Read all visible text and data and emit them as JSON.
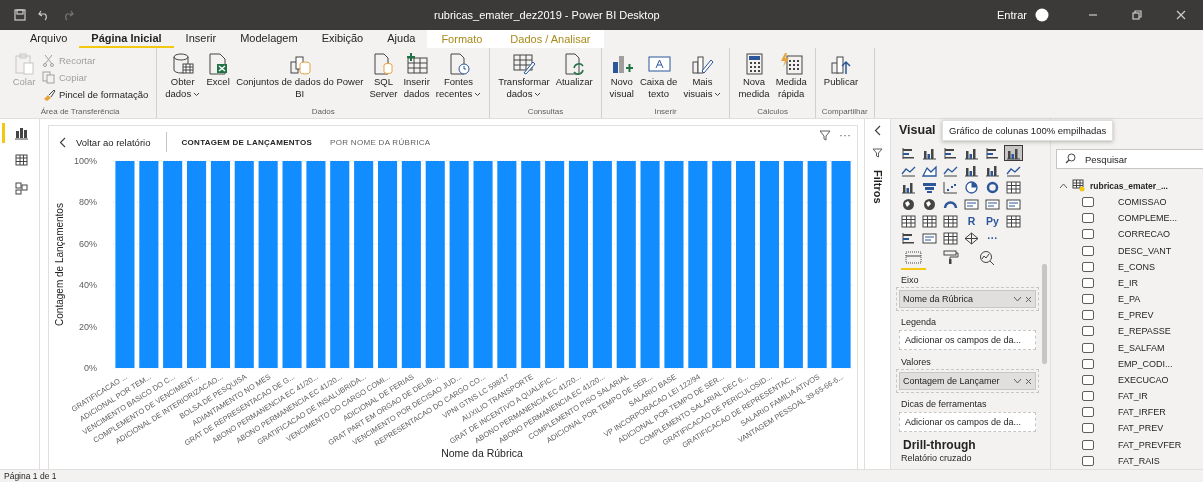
{
  "title_bar": {
    "title": "rubricas_emater_dez2019 - Power BI Desktop",
    "sign_in": "Entrar"
  },
  "ribbon_tabs": [
    {
      "label": "Arquivo",
      "selected": false,
      "kind": "normal"
    },
    {
      "label": "Página Inicial",
      "selected": true,
      "kind": "normal"
    },
    {
      "label": "Inserir",
      "selected": false,
      "kind": "normal"
    },
    {
      "label": "Modelagem",
      "selected": false,
      "kind": "normal"
    },
    {
      "label": "Exibição",
      "selected": false,
      "kind": "normal"
    },
    {
      "label": "Ajuda",
      "selected": false,
      "kind": "normal"
    },
    {
      "label": "Formato",
      "selected": false,
      "kind": "contextual"
    },
    {
      "label": "Dados / Analisar",
      "selected": false,
      "kind": "contextual"
    }
  ],
  "ribbon_groups": [
    {
      "label": "Área de Transferência",
      "buttons": [
        {
          "kind": "large",
          "label": "Colar",
          "disabled": true,
          "dropdown": false
        },
        {
          "kind": "small",
          "label": "Recortar",
          "disabled": true,
          "dropdown": false
        },
        {
          "kind": "small",
          "label": "Copiar",
          "disabled": true,
          "dropdown": false
        },
        {
          "kind": "small",
          "label": "Pincel de formatação",
          "disabled": false,
          "dropdown": false
        }
      ]
    },
    {
      "label": "Dados",
      "buttons": [
        {
          "kind": "large",
          "label": "Obter\ndados",
          "disabled": false,
          "dropdown": true
        },
        {
          "kind": "large",
          "label": "Excel",
          "disabled": false,
          "dropdown": false
        },
        {
          "kind": "large",
          "label": "Conjuntos de dados do Power\nBI",
          "disabled": false,
          "dropdown": false
        },
        {
          "kind": "large",
          "label": "SQL\nServer",
          "disabled": false,
          "dropdown": false
        },
        {
          "kind": "large",
          "label": "Inserir\ndados",
          "disabled": false,
          "dropdown": false
        },
        {
          "kind": "large",
          "label": "Fontes\nrecentes",
          "disabled": false,
          "dropdown": true
        }
      ]
    },
    {
      "label": "Consultas",
      "buttons": [
        {
          "kind": "large",
          "label": "Transformar\ndados",
          "disabled": false,
          "dropdown": true
        },
        {
          "kind": "large",
          "label": "Atualizar",
          "disabled": false,
          "dropdown": false
        }
      ]
    },
    {
      "label": "Inserir",
      "buttons": [
        {
          "kind": "large",
          "label": "Novo\nvisual",
          "disabled": false,
          "dropdown": false
        },
        {
          "kind": "large",
          "label": "Caixa de\ntexto",
          "disabled": false,
          "dropdown": false
        },
        {
          "kind": "large",
          "label": "Mais\nvisuais",
          "disabled": false,
          "dropdown": true
        }
      ]
    },
    {
      "label": "Cálculos",
      "buttons": [
        {
          "kind": "large",
          "label": "Nova\nmedida",
          "disabled": false,
          "dropdown": false
        },
        {
          "kind": "large",
          "label": "Medida\nrápida",
          "disabled": false,
          "dropdown": false
        }
      ]
    },
    {
      "label": "Compartilhar",
      "buttons": [
        {
          "kind": "large",
          "label": "Publicar",
          "disabled": false,
          "dropdown": false
        }
      ]
    }
  ],
  "views": [
    {
      "selected": true
    },
    {
      "selected": false
    },
    {
      "selected": false
    }
  ],
  "visual_header": {
    "back": "Voltar ao relatório",
    "measure": "CONTAGEM DE LANÇAMENTOS",
    "by": "POR NOME DA RÚBRICA",
    "more": "···"
  },
  "chart_data": {
    "type": "bar",
    "xlabel": "Nome da Rúbrica",
    "ylabel": "Contagem de Lançamentos",
    "grid": true,
    "ylim": [
      0,
      100
    ],
    "yticks": [
      {
        "value": 0,
        "label": "0%"
      },
      {
        "value": 20,
        "label": "20%"
      },
      {
        "value": 40,
        "label": "40%"
      },
      {
        "value": 60,
        "label": "60%"
      },
      {
        "value": 80,
        "label": "80%"
      },
      {
        "value": 100,
        "label": "100%"
      }
    ],
    "categories": [
      "GRATIFICACAO ...",
      "ADICIONAL POR TEM...",
      "VENCIMENTO BASICO DO C...",
      "COMPLEMENTO DE VENCIMENT...",
      "ADICIONAL DE INTERIORIZACAO...",
      "BOLSA DE PESQUISA",
      "ADIANTAMENTO NO MES",
      "GRAT DE REPRESENTACAO DE G...",
      "ABONO PERMANENCIA EC 41/20...",
      "ABONO PERMANENCIA EC 41/20...",
      "GRATIFICACAO DE INSALUBRIDA...",
      "VENCIMENTO DO CARGO COMI...",
      "ADICIONAL DE FERIAS",
      "GRAT PART EM ORGAO DE DELIB...",
      "VENCIMENTO POR DECISAO JUD...",
      "REPRESENTACAO DO CARGO CO...",
      "VPNI GTNS LC 598/17",
      "AUXILIO TRANSPORTE",
      "GRAT DE INCENTIVO A QUALIFIC...",
      "ABONO PERMANENCIA EC 41/20...",
      "ABONO PERMANENCIA EC 41/20...",
      "COMPLEMENTO PISO SALARIAL",
      "ADICIONAL POR TEMPO DE SER...",
      "SALARIO BASE",
      "VP INCORPORACAO LEI 122/94",
      "ADICIONAL POR TEMPO DE SER...",
      "COMPLEMENTO SALARIAL DEC 6...",
      "GRATIFICACAO DE PERICULOSID...",
      "GRATIFICACAO DE REPRESENTAC...",
      "SALARIO FAMILIA ATIVOS",
      "VANTAGEM PESSOAL 39-65-66-6..."
    ],
    "series": [
      {
        "color": "#118dff",
        "values": [
          100,
          100,
          100,
          100,
          100,
          100,
          100,
          100,
          100,
          100,
          100,
          100,
          100,
          100,
          100,
          100,
          100,
          100,
          100,
          100,
          100,
          100,
          100,
          100,
          100,
          100,
          100,
          100,
          100,
          100,
          100
        ]
      }
    ]
  },
  "filters_pane": {
    "title": "Filtros"
  },
  "visualizations_pane": {
    "title": "Visual",
    "tooltip": "Gráfico de colunas 100% empilhadas",
    "visual_types": [
      {
        "kind": "icon",
        "selected": false
      },
      {
        "kind": "icon",
        "selected": false
      },
      {
        "kind": "icon",
        "selected": false
      },
      {
        "kind": "icon",
        "selected": false
      },
      {
        "kind": "icon",
        "selected": false
      },
      {
        "kind": "icon",
        "selected": true
      },
      {
        "kind": "icon",
        "selected": false
      },
      {
        "kind": "icon",
        "selected": false
      },
      {
        "kind": "icon",
        "selected": false
      },
      {
        "kind": "icon",
        "selected": false
      },
      {
        "kind": "icon",
        "selected": false
      },
      {
        "kind": "icon",
        "selected": false
      },
      {
        "kind": "icon",
        "selected": false
      },
      {
        "kind": "icon",
        "selected": false
      },
      {
        "kind": "icon",
        "selected": false
      },
      {
        "kind": "icon",
        "selected": false
      },
      {
        "kind": "icon",
        "selected": false
      },
      {
        "kind": "icon",
        "selected": false
      },
      {
        "kind": "icon",
        "selected": false
      },
      {
        "kind": "icon",
        "selected": false
      },
      {
        "kind": "icon",
        "selected": false
      },
      {
        "kind": "icon",
        "selected": false
      },
      {
        "kind": "icon",
        "selected": false
      },
      {
        "kind": "icon",
        "selected": false
      },
      {
        "kind": "icon",
        "selected": false
      },
      {
        "kind": "icon",
        "selected": false
      },
      {
        "kind": "icon",
        "selected": false
      },
      {
        "kind": "text",
        "text": "R",
        "selected": false
      },
      {
        "kind": "text",
        "text": "Py",
        "selected": false
      },
      {
        "kind": "icon",
        "selected": false
      },
      {
        "kind": "icon",
        "selected": false
      },
      {
        "kind": "icon",
        "selected": false
      },
      {
        "kind": "icon",
        "selected": false
      },
      {
        "kind": "icon",
        "selected": false
      },
      {
        "kind": "text",
        "text": "···",
        "selected": false
      }
    ],
    "pane_tabs": [
      {
        "selected": true
      },
      {
        "selected": false
      },
      {
        "selected": false
      }
    ],
    "wells": [
      {
        "label": "Eixo",
        "kind": "field",
        "value": "Nome da Rúbrica"
      },
      {
        "label": "Legenda",
        "kind": "empty",
        "placeholder": "Adicionar os campos de da..."
      },
      {
        "label": "Valores",
        "kind": "field",
        "value": "Contagem de Lançamer"
      },
      {
        "label": "Dicas de ferramentas",
        "kind": "empty",
        "placeholder": "Adicionar os campos de da..."
      }
    ],
    "drill_through": {
      "title": "Drill-through",
      "subtitle": "Relatório cruzado"
    }
  },
  "fields_pane": {
    "search": {
      "placeholder": "Pesquisar"
    },
    "table": {
      "name": "rubricas_emater_...",
      "expanded": true,
      "fields": [
        {
          "name": "COMISSAO",
          "checked": false
        },
        {
          "name": "COMPLEME...",
          "checked": false
        },
        {
          "name": "CORRECAO",
          "checked": false
        },
        {
          "name": "DESC_VANT",
          "checked": false
        },
        {
          "name": "E_CONS",
          "checked": false
        },
        {
          "name": "E_IR",
          "checked": false
        },
        {
          "name": "E_PA",
          "checked": false
        },
        {
          "name": "E_PREV",
          "checked": false
        },
        {
          "name": "E_REPASSE",
          "checked": false
        },
        {
          "name": "E_SALFAM",
          "checked": false
        },
        {
          "name": "EMP_CODI...",
          "checked": false
        },
        {
          "name": "EXECUCAO",
          "checked": false
        },
        {
          "name": "FAT_IR",
          "checked": false
        },
        {
          "name": "FAT_IRFER",
          "checked": false
        },
        {
          "name": "FAT_PREV",
          "checked": false
        },
        {
          "name": "FAT_PREVFER",
          "checked": false
        },
        {
          "name": "FAT_RAIS",
          "checked": false
        }
      ]
    }
  },
  "status_bar": {
    "page": "Página 1 de 1"
  }
}
